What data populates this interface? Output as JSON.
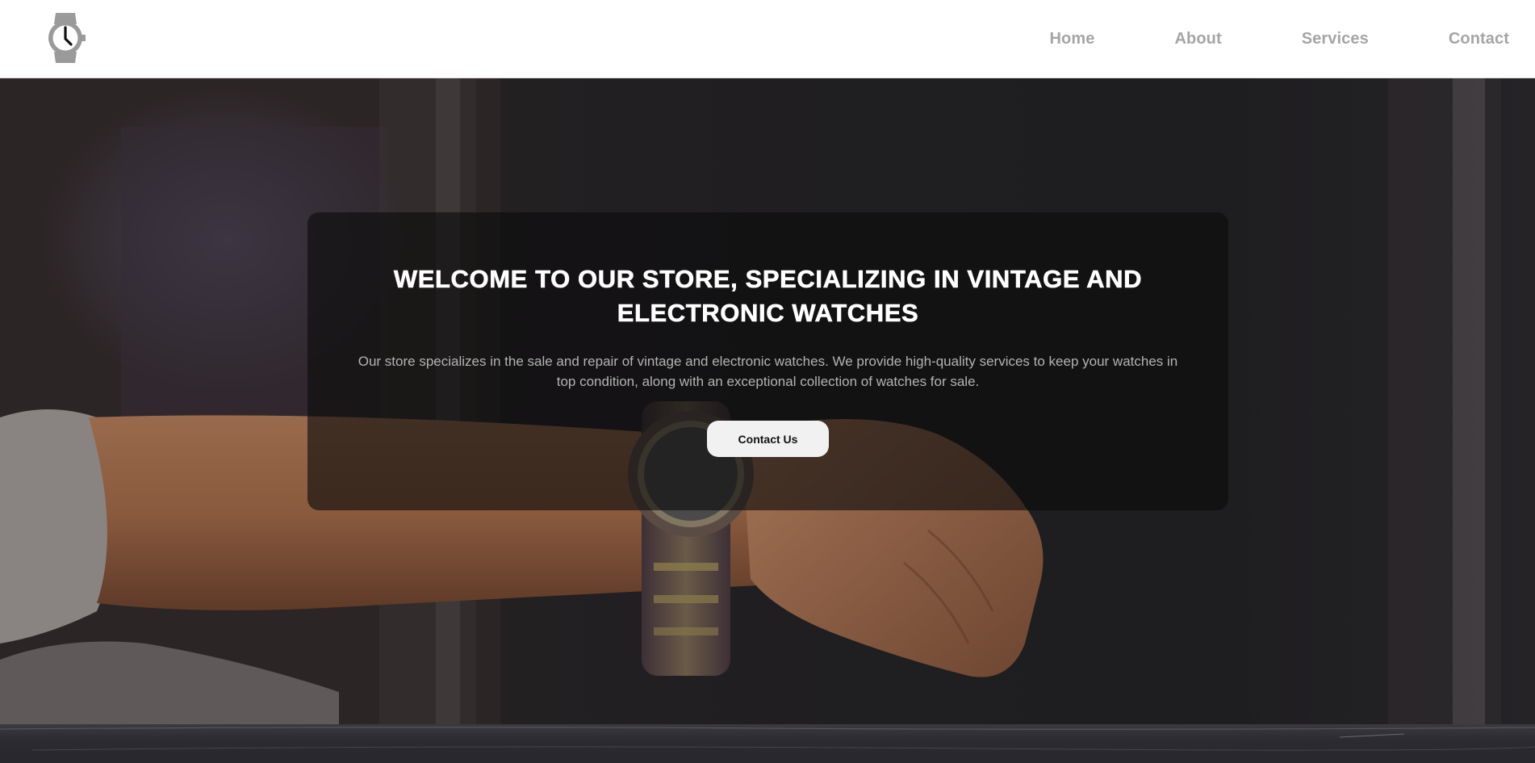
{
  "header": {
    "logo_icon": "watch-icon",
    "nav": [
      {
        "label": "Home"
      },
      {
        "label": "About"
      },
      {
        "label": "Services"
      },
      {
        "label": "Contact"
      }
    ]
  },
  "hero": {
    "background": "photo-wrist-watch",
    "title": "WELCOME TO OUR STORE, SPECIALIZING IN VINTAGE AND ELECTRONIC WATCHES",
    "description": "Our store specializes in the sale and repair of vintage and electronic watches. We provide high-quality services to keep your watches in top condition, along with an exceptional collection of watches for sale.",
    "cta_label": "Contact Us"
  },
  "colors": {
    "nav_text": "#a5a5a5",
    "header_bg": "#ffffff",
    "card_bg": "rgba(12,12,12,0.62)",
    "button_bg": "#f1f1f1"
  }
}
